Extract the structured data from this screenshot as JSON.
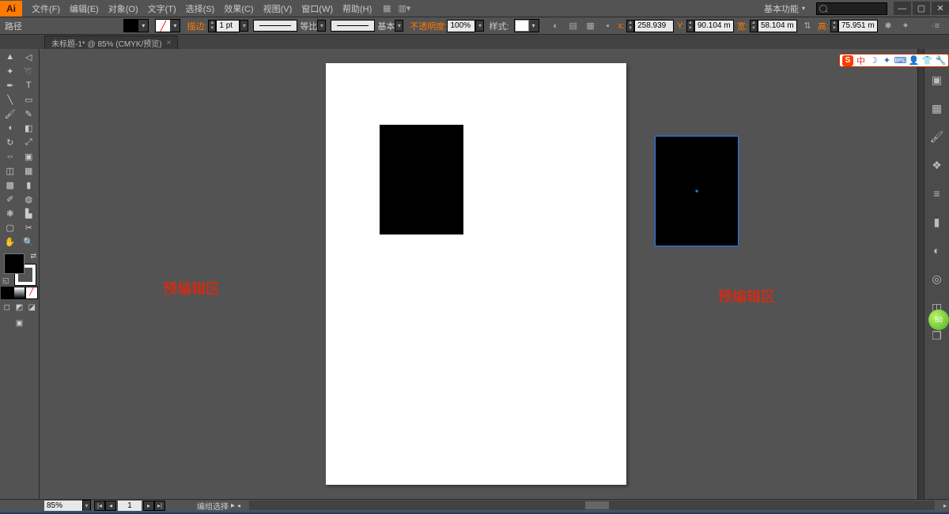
{
  "app": {
    "logo": "Ai"
  },
  "menu": {
    "file": "文件(F)",
    "edit": "编辑(E)",
    "object": "对象(O)",
    "type": "文字(T)",
    "select": "选择(S)",
    "effect": "效果(C)",
    "view": "视图(V)",
    "window": "窗口(W)",
    "help": "帮助(H)"
  },
  "workspace": {
    "label": "基本功能"
  },
  "controlbar": {
    "left_label": "路径",
    "stroke_label": "描边:",
    "stroke_value": "1 pt",
    "line1_label": "等比",
    "line2_label": "基本",
    "opacity_label": "不透明度:",
    "opacity_value": "100%",
    "style_label": "样式:",
    "x_label": "x:",
    "x_value": "258.939",
    "y_label": "Y:",
    "y_value": "90.104  m",
    "w_label": "宽:",
    "w_value": "58.104  m",
    "h_label": "高:",
    "h_value": "75.951  m"
  },
  "doc_tab": {
    "title": "未标题-1* @ 85% (CMYK/预览)"
  },
  "canvas": {
    "anno_left": "预编辑区",
    "anno_right": "预编辑区"
  },
  "statusbar": {
    "zoom": "85%",
    "artboard_index": "1",
    "selection": "编组选择"
  },
  "float_pill": {
    "logo": "S",
    "cn": "中"
  },
  "colors": {
    "accent": "#ff7a00",
    "selection": "#2a7bff",
    "anno": "#ff1e00"
  }
}
